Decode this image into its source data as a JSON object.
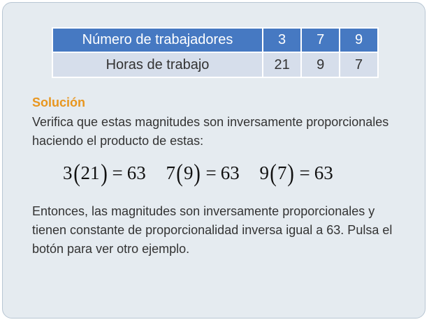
{
  "table": {
    "header": {
      "label": "Número de trabajadores",
      "values": [
        "3",
        "7",
        "9"
      ]
    },
    "row": {
      "label": "Horas de trabajo",
      "values": [
        "21",
        "9",
        "7"
      ]
    }
  },
  "solution": {
    "title": "Solución",
    "intro": "Verifica que estas magnitudes son inversamente proporcionales haciendo el producto de estas:",
    "equations": [
      {
        "a": "3",
        "b": "21",
        "result": "63"
      },
      {
        "a": "7",
        "b": "9",
        "result": "63"
      },
      {
        "a": "9",
        "b": "7",
        "result": "63"
      }
    ],
    "equals_sign": "=",
    "open_paren": "(",
    "close_paren": ")",
    "conclusion": "Entonces, las magnitudes son inversamente proporcionales y tienen constante de proporcionalidad inversa igual a 63. Pulsa el botón para ver otro ejemplo."
  }
}
